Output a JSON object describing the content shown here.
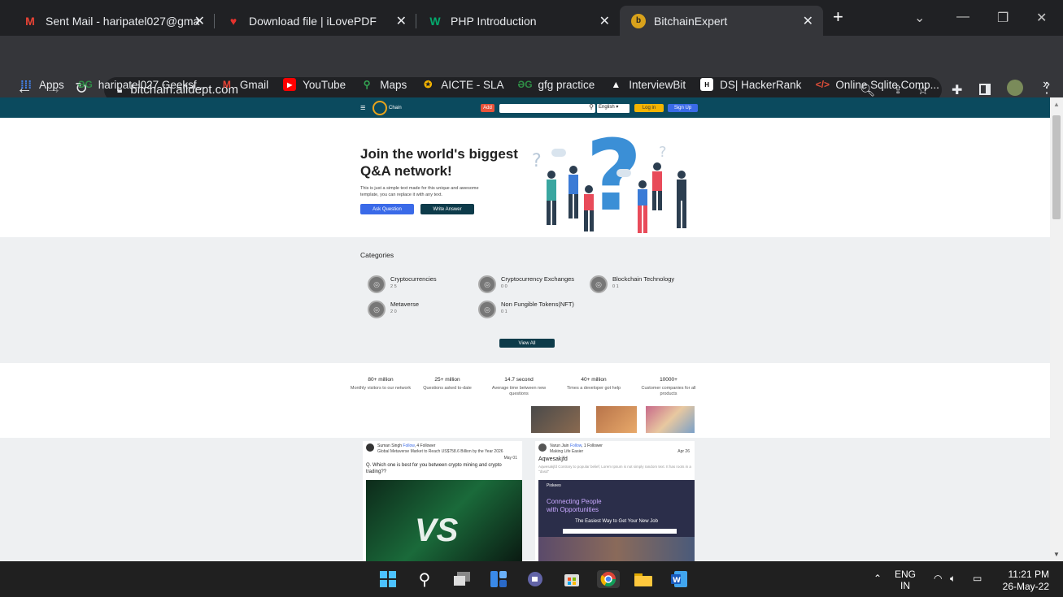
{
  "tabs": [
    {
      "title": "Sent Mail - haripatel027@gma",
      "icon": "gmail-icon"
    },
    {
      "title": "Download file | iLovePDF",
      "icon": "ilovepdf-icon"
    },
    {
      "title": "PHP Introduction",
      "icon": "w3schools-icon"
    },
    {
      "title": "BitchainExpert",
      "icon": "bitchain-icon"
    }
  ],
  "address": {
    "url": "bitchain.alldept.com"
  },
  "bookmarks": [
    {
      "label": "Apps"
    },
    {
      "label": "haripatel027 Geeksf..."
    },
    {
      "label": "Gmail"
    },
    {
      "label": "YouTube"
    },
    {
      "label": "Maps"
    },
    {
      "label": "AICTE - SLA"
    },
    {
      "label": "gfg practice"
    },
    {
      "label": "InterviewBit"
    },
    {
      "label": "DS| HackerRank"
    },
    {
      "label": "Online Sqlite Comp..."
    }
  ],
  "site": {
    "logo_text": "Chain",
    "add_label": "Add",
    "language": "English",
    "login_label": "Log in",
    "signup_label": "Sign Up"
  },
  "hero": {
    "title_line1": "Join the world's biggest",
    "title_line2": "Q&A network!",
    "subtitle_line1": "This is just a simple text made for this unique and awesome",
    "subtitle_line2": "template, you can replace it with any text.",
    "ask_label": "Ask Question",
    "write_label": "Write Answer"
  },
  "categories": {
    "heading": "Categories",
    "items": [
      {
        "name": "Cryptocurrencies",
        "counts": "2 5"
      },
      {
        "name": "Cryptocurrency Exchanges",
        "counts": "0 0"
      },
      {
        "name": "Blockchain Technology",
        "counts": "0 1"
      },
      {
        "name": "Metaverse",
        "counts": "2 0"
      },
      {
        "name": "Non Fungible Tokens(NFT)",
        "counts": "0 1"
      }
    ],
    "view_all": "View All"
  },
  "stats": [
    {
      "value": "80+ million",
      "label": "Monthly visitors to our network"
    },
    {
      "value": "25+ million",
      "label": "Questions asked to-date"
    },
    {
      "value": "14.7 second",
      "label": "Average time between new questions"
    },
    {
      "value": "40+ million",
      "label": "Times a developer got help"
    },
    {
      "value": "10000+",
      "label": "Customer companies for all products"
    }
  ],
  "posts": [
    {
      "author": "Suman Singh",
      "follow": "Follow",
      "followers": "4 Follower",
      "subtitle": "Global Metaverse Market to Reach US$758.6 Billion by the Year 2026",
      "date": "May 01",
      "question": "Q. Which one is best for you between crypto mining and crypto trading??"
    },
    {
      "author": "Varun Jain",
      "follow": "Follow",
      "followers": "1 Follower",
      "subtitle": "Making Life Easier",
      "date": "Apr 26",
      "question": "Aqwesakjfd",
      "body": "Aqwesakjfd Contrary to popular belief, Lorem Ipsum is not simply random text. It has roots in a ''dasd''"
    }
  ],
  "post2_image": {
    "brand": "Pixkeeo",
    "headline1": "Connecting People",
    "headline2": "with Opportunities",
    "tagline": "The Easiest Way to Get Your New Job"
  },
  "taskbar": {
    "lang_top": "ENG",
    "lang_bottom": "IN",
    "time": "11:21 PM",
    "date": "26-May-22"
  },
  "colors": {
    "header": "#0b4a5e",
    "primary": "#3a6ae8",
    "dark": "#0d3b4a",
    "add": "#e8533a",
    "login": "#f5b400"
  }
}
